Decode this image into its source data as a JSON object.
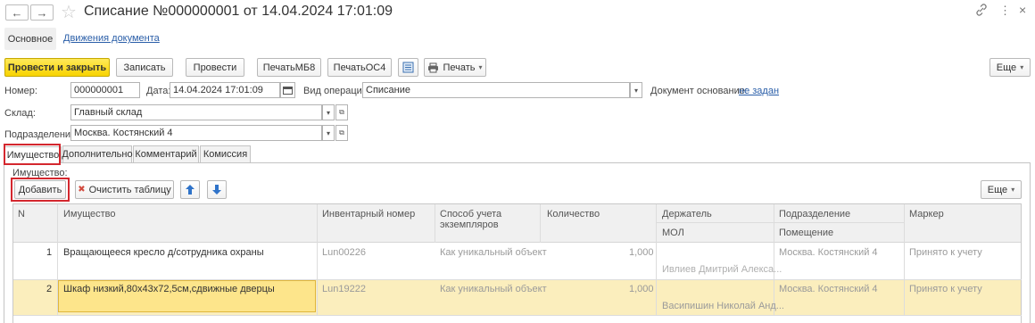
{
  "window": {
    "back_glyph": "←",
    "forward_glyph": "→",
    "favorite_glyph": "☆",
    "title": "Списание №000000001 от 14.04.2024 17:01:09",
    "link_glyph": "🔗",
    "menu_glyph": "⋮",
    "close_glyph": "×"
  },
  "sections": {
    "main": "Основное",
    "movements": "Движения документа"
  },
  "toolbar": {
    "post_close": "Провести и закрыть",
    "save": "Записать",
    "post": "Провести",
    "print_mb8": "ПечатьМБ8",
    "print_os4": "ПечатьОС4",
    "print": "Печать",
    "more": "Еще"
  },
  "form": {
    "number_label": "Номер:",
    "number_value": "000000001",
    "date_label": "Дата:",
    "date_value": "14.04.2024 17:01:09",
    "op_label": "Вид операции:",
    "op_value": "Списание",
    "basis_label": "Документ основание:",
    "basis_value": "не задан",
    "warehouse_label": "Склад:",
    "warehouse_value": "Главный склад",
    "division_label": "Подразделение:",
    "division_value": "Москва. Костянский 4"
  },
  "tabs": [
    "Имущество",
    "Дополнительно",
    "Комментарий",
    "Комиссия"
  ],
  "panel": {
    "group_label": "Имущество:",
    "add": "Добавить",
    "clear": "Очистить таблицу",
    "more": "Еще"
  },
  "table": {
    "columns": {
      "n": "N",
      "property": "Имущество",
      "inventory": "Инвентарный номер",
      "method": "Способ учета экземпляров",
      "quantity": "Количество",
      "holder": "Держатель",
      "mol": "МОЛ",
      "division": "Подразделение",
      "room": "Помещение",
      "marker": "Маркер"
    },
    "rows": [
      {
        "n": "1",
        "property": "Вращающееся кресло д/сотрудника охраны",
        "inventory": "Lun00226",
        "method": "Как уникальный объект",
        "quantity": "1,000",
        "mol": "Ивлиев Дмитрий Алекса...",
        "division": "Москва. Костянский 4",
        "marker": "Принято к учету"
      },
      {
        "n": "2",
        "property": "Шкаф низкий,80х43х72,5см,сдвижные дверцы",
        "inventory": "Lun19222",
        "method": "Как уникальный объект",
        "quantity": "1,000",
        "mol": "Васипишин Николай Анд...",
        "division": "Москва. Костянский 4",
        "marker": "Принято к учету"
      }
    ]
  },
  "colors": {
    "primary": "#f8d300",
    "highlight_red": "#d4272e",
    "selected_row": "#fbeebd",
    "link": "#2a5ea8"
  }
}
